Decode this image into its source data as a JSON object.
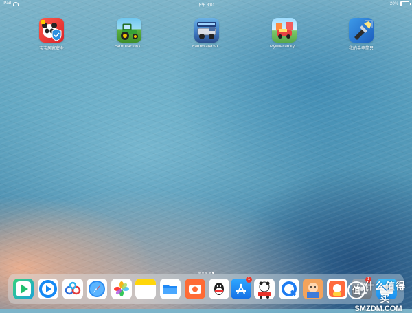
{
  "status_bar": {
    "device": "iPad",
    "time": "下午 3:01",
    "battery_text": "20%",
    "battery_level": 0.2
  },
  "home_apps": [
    {
      "label": "宝宝居家安全",
      "icon": "panda-safety-icon"
    },
    {
      "label": "FarmTractorG...",
      "icon": "tractor-icon"
    },
    {
      "label": "FarmWaterSu...",
      "icon": "water-truck-icon"
    },
    {
      "label": "Mylittlecarcityl...",
      "icon": "car-city-icon"
    },
    {
      "label": "我的手电筒只",
      "icon": "flashlight-icon"
    }
  ],
  "page_dots": {
    "count": 5,
    "active": 4
  },
  "dock_badges": {
    "app_store": "1",
    "mail": "1"
  },
  "dock_icons": [
    "video-player-icon",
    "video-play-icon",
    "baidu-paw-icon",
    "safari-icon",
    "photos-icon",
    "notes-icon",
    "files-icon",
    "camera-icon",
    "qq-icon",
    "app-store-icon",
    "kids-game-icon",
    "quark-icon",
    "kids-story-icon",
    "kids-learning-icon",
    "settings-icon",
    "mail-icon"
  ],
  "watermark": {
    "cn": "什么值得买",
    "en": "SMZDM.COM",
    "logo": "值"
  }
}
